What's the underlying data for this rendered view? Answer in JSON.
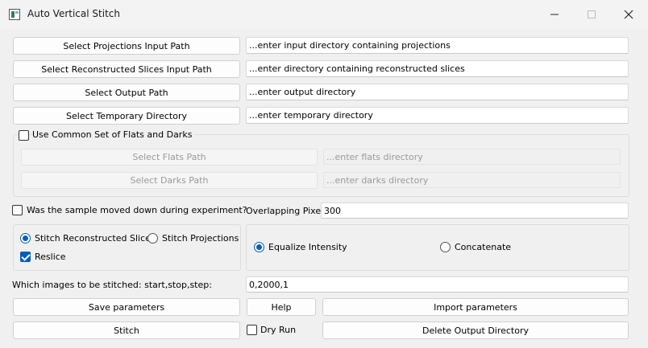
{
  "window": {
    "title": "Auto Vertical Stitch",
    "controls": [
      "minimize-icon",
      "maximize-icon",
      "close-icon"
    ]
  },
  "paths": [
    {
      "button": "Select Projections Input Path",
      "placeholder": "...enter input directory containing projections"
    },
    {
      "button": "Select Reconstructed Slices Input Path",
      "placeholder": "...enter directory containing reconstructed slices"
    },
    {
      "button": "Select Output Path",
      "placeholder": "...enter output directory"
    },
    {
      "button": "Select Temporary Directory",
      "placeholder": "...enter temporary directory"
    }
  ],
  "flats_darks": {
    "checkbox_label": "Use Common Set of Flats and Darks",
    "checked": false,
    "flats_button": "Select Flats Path",
    "flats_placeholder": "...enter flats directory",
    "darks_button": "Select Darks Path",
    "darks_placeholder": "...enter darks directory"
  },
  "sample_moved": {
    "label": "Was the sample moved down during experiment?",
    "checked": false
  },
  "overlap": {
    "label": "Overlapping Pixels",
    "value": "300"
  },
  "stitch_mode": {
    "options": [
      "Stitch Reconstructed Slices",
      "Stitch Projections"
    ],
    "selected": "Stitch Reconstructed Slices",
    "reslice_label": "Reslice",
    "reslice_checked": true
  },
  "intensity_mode": {
    "options": [
      "Equalize Intensity",
      "Concatenate"
    ],
    "selected": "Equalize Intensity"
  },
  "range": {
    "label": "Which images to be stitched: start,stop,step:",
    "value": "0,2000,1"
  },
  "actions": {
    "save": "Save parameters",
    "help": "Help",
    "import": "Import parameters",
    "stitch": "Stitch",
    "dry_run": "Dry Run",
    "dry_run_checked": false,
    "delete": "Delete Output Directory"
  },
  "colors": {
    "accent": "#005fb8",
    "background": "#f0f0f0"
  }
}
